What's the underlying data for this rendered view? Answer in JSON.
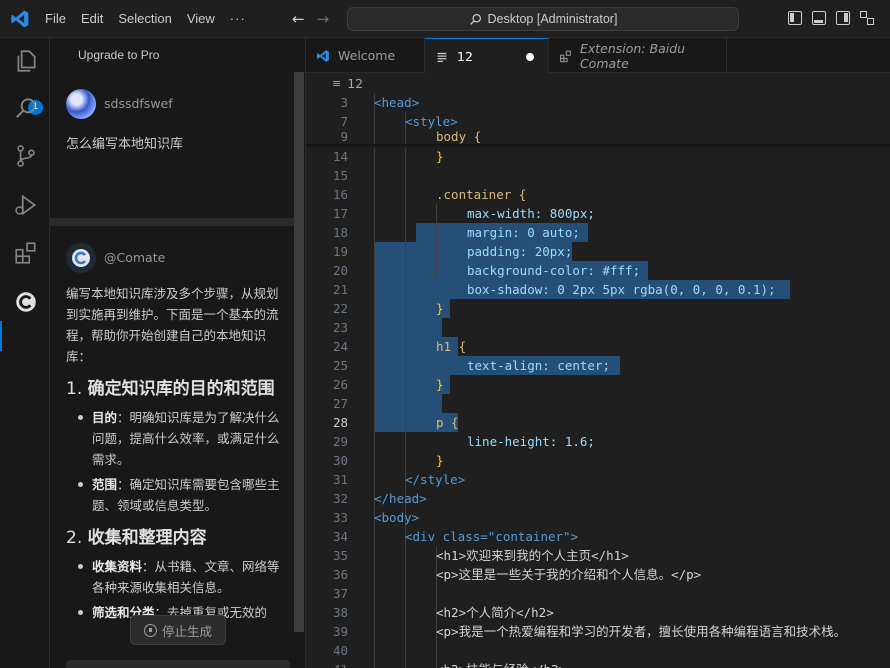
{
  "titlebar": {
    "menu": [
      "File",
      "Edit",
      "Selection",
      "View",
      "···"
    ],
    "command_center": "Desktop [Administrator]"
  },
  "activity": {
    "explorer_badge": "1"
  },
  "panel": {
    "upgrade": "Upgrade to Pro",
    "user_name": "sdssdfswef",
    "user_message": "怎么编写本地知识库",
    "bot_name": "@Comate",
    "bot_intro": "编写本地知识库涉及多个步骤，从规划到实施再到维护。下面是一个基本的流程，帮助你开始创建自己的本地知识库：",
    "section1_num": "1.",
    "section1_title": "确定知识库的目的和范围",
    "s1_item1_label": "目的",
    "s1_item1_text": "：明确知识库是为了解决什么问题，提高什么效率，或满足什么需求。",
    "s1_item2_label": "范围",
    "s1_item2_text": "：确定知识库需要包含哪些主题、领域或信息类型。",
    "section2_num": "2.",
    "section2_title": "收集和整理内容",
    "s2_item1_label": "收集资料",
    "s2_item1_text": "：从书籍、文章、网络等各种来源收集相关信息。",
    "s2_item2_label": "筛选和分类",
    "s2_item2_text": "：去掉重复或无效的",
    "stop_button": "停止生成"
  },
  "tabs": [
    {
      "label": "Welcome"
    },
    {
      "label": "12"
    },
    {
      "label": "Extension: Baidu Comate"
    }
  ],
  "breadcrumb": "12",
  "code_lines": [
    {
      "n": "3",
      "t": "<head>"
    },
    {
      "n": "7",
      "t": "<style>"
    },
    {
      "n": "9",
      "t": "body {"
    },
    {
      "n": "14",
      "t": "}"
    },
    {
      "n": "15",
      "t": ""
    },
    {
      "n": "16",
      "t": ".container {"
    },
    {
      "n": "17",
      "t": "max-width: 800px;"
    },
    {
      "n": "18",
      "t": "margin: 0 auto;"
    },
    {
      "n": "19",
      "t": "padding: 20px;"
    },
    {
      "n": "20",
      "t": "background-color: #fff;"
    },
    {
      "n": "21",
      "t": "box-shadow: 0 2px 5px rgba(0, 0, 0, 0.1);"
    },
    {
      "n": "22",
      "t": "}"
    },
    {
      "n": "23",
      "t": ""
    },
    {
      "n": "24",
      "t": "h1 {"
    },
    {
      "n": "25",
      "t": "text-align: center;"
    },
    {
      "n": "26",
      "t": "}"
    },
    {
      "n": "27",
      "t": ""
    },
    {
      "n": "28",
      "t": "p {"
    },
    {
      "n": "29",
      "t": "line-height: 1.6;"
    },
    {
      "n": "30",
      "t": "}"
    },
    {
      "n": "31",
      "t": "</style>"
    },
    {
      "n": "32",
      "t": "</head>"
    },
    {
      "n": "33",
      "t": "<body>"
    },
    {
      "n": "34",
      "t": "<div class=\"container\">"
    },
    {
      "n": "35",
      "t": "<h1>欢迎来到我的个人主页</h1>"
    },
    {
      "n": "36",
      "t": "<p>这里是一些关于我的介绍和个人信息。</p>"
    },
    {
      "n": "37",
      "t": ""
    },
    {
      "n": "38",
      "t": "<h2>个人简介</h2>"
    },
    {
      "n": "39",
      "t": "<p>我是一个热爱编程和学习的开发者，擅长使用各种编程语言和技术栈。"
    },
    {
      "n": "40",
      "t": ""
    },
    {
      "n": "41",
      "t": "<h2>技能与经验</h2>"
    }
  ],
  "colors": {
    "accent": "#0078d4",
    "selection": "#264f78",
    "tag": "#569cd6",
    "selector": "#d7ba7d",
    "property": "#9cdcfe",
    "value": "#ce9178",
    "bracket": "#ffd700"
  },
  "icons": [
    "vscode-logo-icon",
    "arrow-left-icon",
    "arrow-right-icon",
    "search-icon",
    "toggle-primary-sidebar-icon",
    "toggle-panel-icon",
    "toggle-secondary-sidebar-icon",
    "customize-layout-icon",
    "files-icon",
    "search-icon",
    "source-control-icon",
    "run-debug-icon",
    "extensions-icon",
    "comate-icon",
    "help-icon",
    "user-voice-icon",
    "plugins-icon",
    "gear-icon",
    "list-icon",
    "stop-icon"
  ]
}
